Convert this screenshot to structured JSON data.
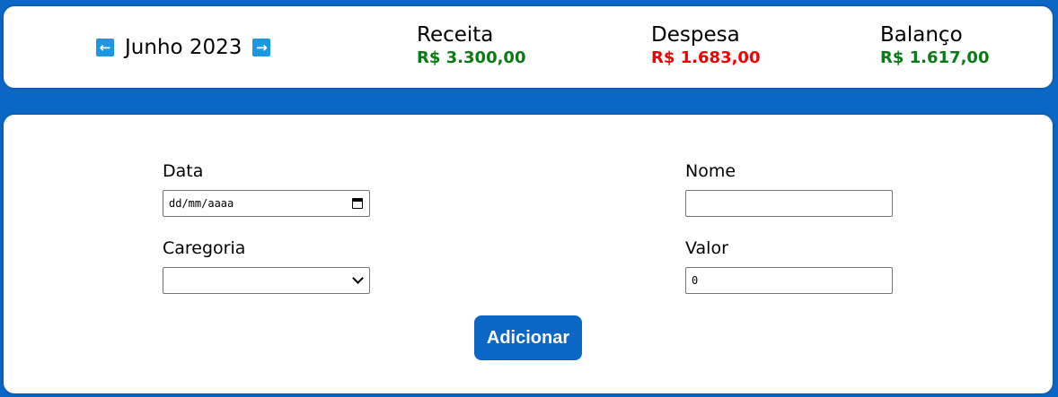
{
  "header": {
    "month_title": "Junho 2023",
    "prev_icon": "←",
    "next_icon": "→"
  },
  "summary": {
    "income": {
      "label": "Receita",
      "value": "R$ 3.300,00",
      "color": "#0a7a16"
    },
    "expense": {
      "label": "Despesa",
      "value": "R$ 1.683,00",
      "color": "#f00000"
    },
    "balance": {
      "label": "Balanço",
      "value": "R$ 1.617,00",
      "color": "#0a7a16"
    }
  },
  "form": {
    "date": {
      "label": "Data",
      "placeholder": "dd/mm/aaaa",
      "icon": "calendar-icon"
    },
    "name": {
      "label": "Nome",
      "value": ""
    },
    "category": {
      "label": "Caregoria",
      "value": "",
      "icon": "chevron-down-icon"
    },
    "amount": {
      "label": "Valor",
      "value": "0"
    },
    "submit_label": "Adicionar"
  },
  "colors": {
    "accent": "#0b66c6",
    "arrow_button": "#1a98e3"
  }
}
